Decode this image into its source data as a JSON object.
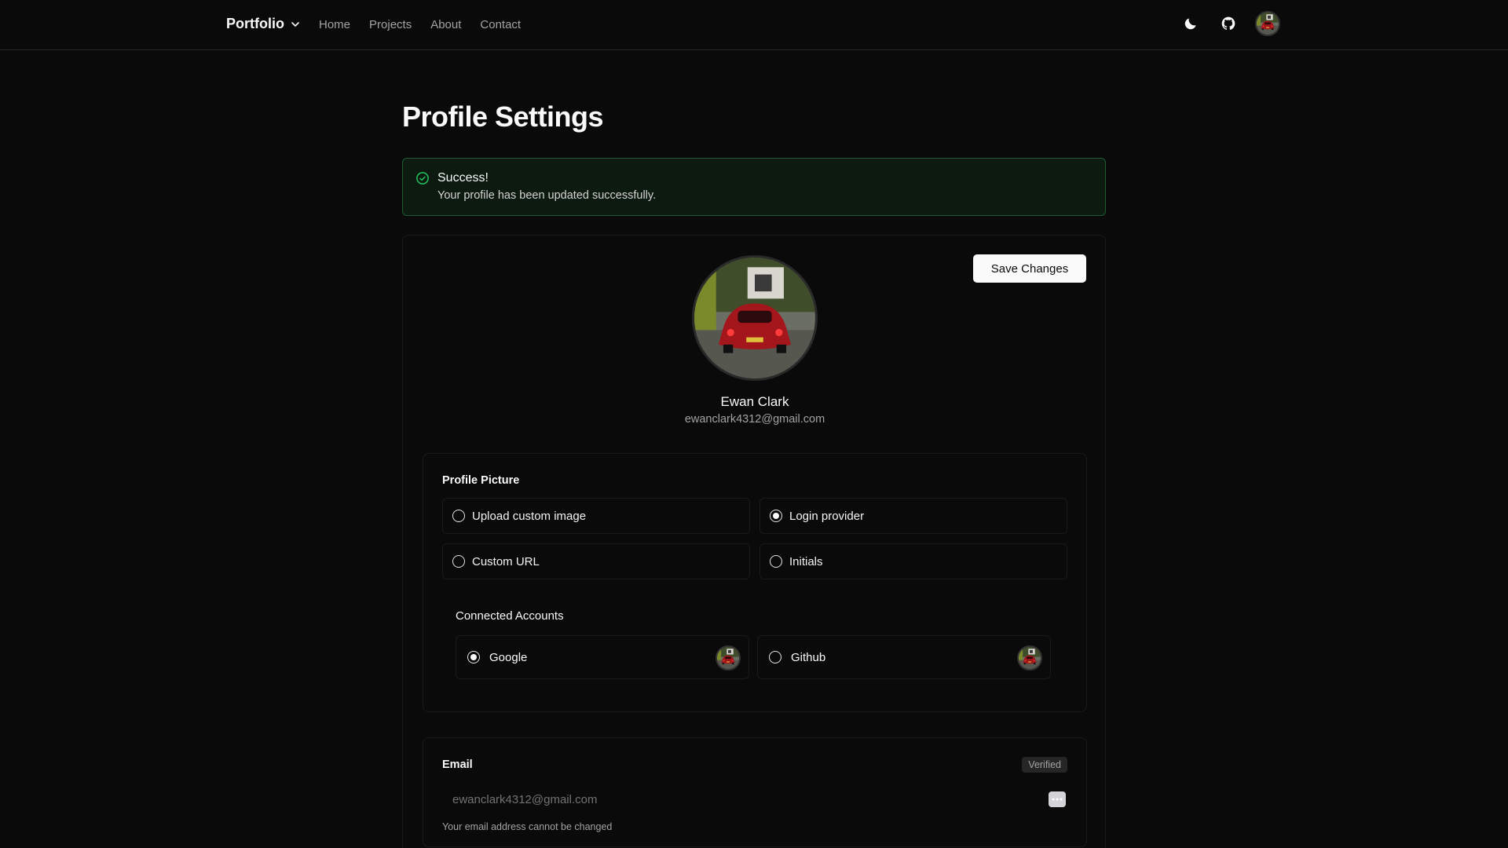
{
  "nav": {
    "brand": "Portfolio",
    "links": [
      "Home",
      "Projects",
      "About",
      "Contact"
    ],
    "icons": [
      "moon-icon",
      "github-icon",
      "avatar"
    ]
  },
  "page": {
    "title": "Profile Settings"
  },
  "alert": {
    "title": "Success!",
    "description": "Your profile has been updated successfully.",
    "color": "#22c55e"
  },
  "profile": {
    "save_label": "Save Changes",
    "name": "Ewan Clark",
    "email": "ewanclark4312@gmail.com"
  },
  "picture": {
    "label": "Profile Picture",
    "options": [
      {
        "label": "Upload custom image",
        "selected": false
      },
      {
        "label": "Login provider",
        "selected": true
      },
      {
        "label": "Custom URL",
        "selected": false
      },
      {
        "label": "Initials",
        "selected": false
      }
    ],
    "connected_title": "Connected Accounts",
    "accounts": [
      {
        "label": "Google",
        "selected": true
      },
      {
        "label": "Github",
        "selected": false
      }
    ]
  },
  "email_section": {
    "label": "Email",
    "badge": "Verified",
    "placeholder": "ewanclark4312@gmail.com",
    "help": "Your email address cannot be changed"
  }
}
